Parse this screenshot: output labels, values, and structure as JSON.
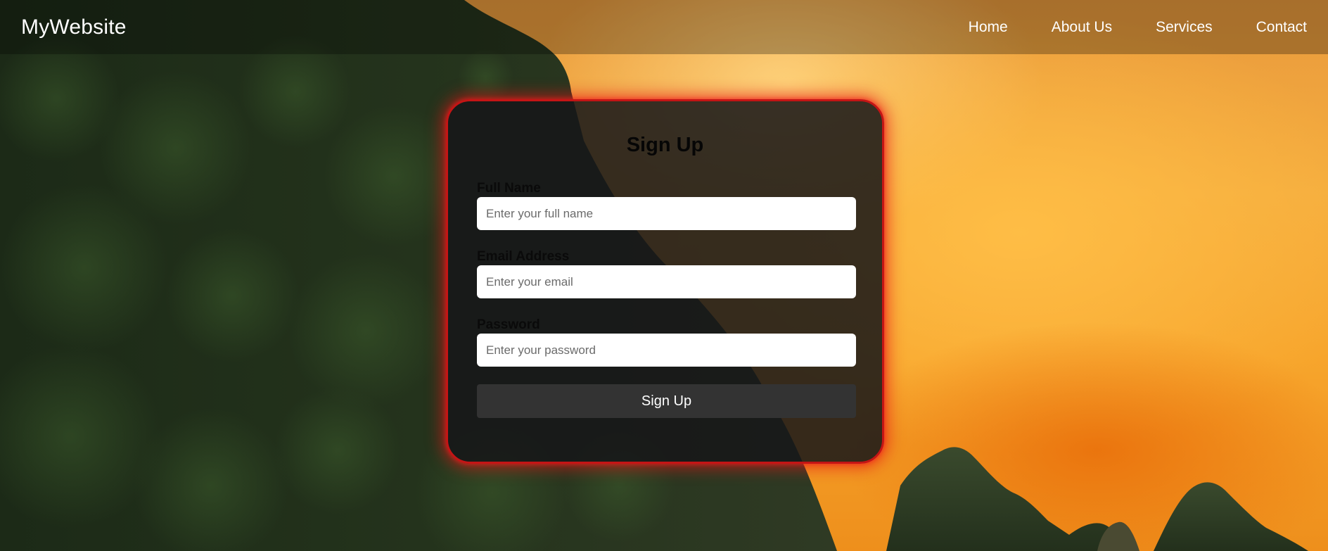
{
  "nav": {
    "brand": "MyWebsite",
    "links": [
      {
        "label": "Home"
      },
      {
        "label": "About Us"
      },
      {
        "label": "Services"
      },
      {
        "label": "Contact"
      }
    ]
  },
  "signup": {
    "title": "Sign Up",
    "fields": [
      {
        "label": "Full Name",
        "placeholder": "Enter your full name",
        "value": ""
      },
      {
        "label": "Email Address",
        "placeholder": "Enter your email",
        "value": ""
      },
      {
        "label": "Password",
        "placeholder": "Enter your password",
        "value": ""
      }
    ],
    "submit_label": "Sign Up"
  },
  "colors": {
    "card_border": "#c41515",
    "card_glow": "#e61414",
    "button_bg": "#333333"
  }
}
